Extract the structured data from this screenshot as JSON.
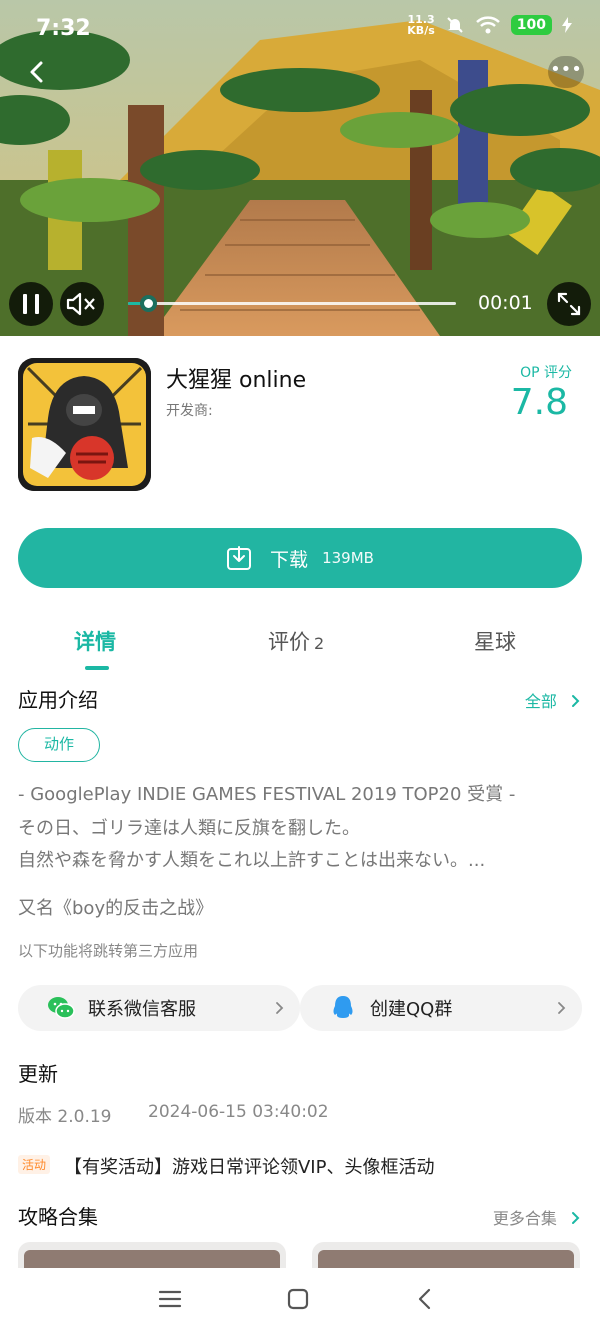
{
  "status_bar": {
    "time": "7:32",
    "net_speed_value": "11.3",
    "net_speed_unit": "KB/s",
    "battery": "100"
  },
  "video": {
    "elapsed": "00:01",
    "progress": 0.06
  },
  "app": {
    "name": "大猩猩 online",
    "developer_label": "开发商:",
    "rating_label": "OP 评分",
    "rating_value": "7.8"
  },
  "download": {
    "label": "下载",
    "size": "139MB"
  },
  "tabs": [
    {
      "label": "详情",
      "active": true
    },
    {
      "label": "评价",
      "count": "2"
    },
    {
      "label": "星球"
    }
  ],
  "intro": {
    "title": "应用介绍",
    "all_label": "全部",
    "tag": "动作",
    "desc_lines": [
      "- GooglePlay INDIE GAMES FESTIVAL 2019 TOP20 受賞 -",
      "その日、ゴリラ達は人類に反旗を翻した。",
      "自然や森を脅かす人類をこれ以上許すことは出来ない。..."
    ],
    "alias": "又名《boy的反击之战》",
    "third_party_note": "以下功能将跳转第三方应用"
  },
  "contacts": {
    "wechat_label": "联系微信客服",
    "qq_label": "创建QQ群"
  },
  "update": {
    "title": "更新",
    "version": "版本 2.0.19",
    "date": "2024-06-15 03:40:02",
    "activity_badge": "活动",
    "activity_text": "【有奖活动】游戏日常评论领VIP、头像框活动"
  },
  "guides": {
    "title": "攻略合集",
    "more_label": "更多合集"
  },
  "colors": {
    "accent": "#22b5a2",
    "accent_text": "#1bb8a4",
    "activity": "#ff8a2b"
  },
  "icons": [
    "pause-icon",
    "mute-icon",
    "fullscreen-icon",
    "back-icon",
    "more-icon",
    "download-icon",
    "wechat-icon",
    "qq-icon",
    "chevron-right-icon",
    "menu-icon",
    "home-icon",
    "nav-back-icon"
  ]
}
